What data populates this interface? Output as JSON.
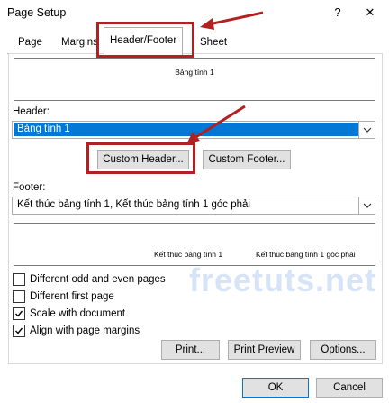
{
  "window": {
    "title": "Page Setup",
    "help_glyph": "?",
    "close_glyph": "✕"
  },
  "tabs": [
    {
      "label": "Page"
    },
    {
      "label": "Margins"
    },
    {
      "label": "Header/Footer",
      "selected": true
    },
    {
      "label": "Sheet"
    }
  ],
  "header_preview": {
    "text": "Bảng tính 1"
  },
  "header": {
    "label": "Header:",
    "value": "Bảng tính 1"
  },
  "buttons": {
    "custom_header": "Custom Header...",
    "custom_footer": "Custom Footer...",
    "print": "Print...",
    "print_preview": "Print Preview",
    "options": "Options...",
    "ok": "OK",
    "cancel": "Cancel"
  },
  "footer": {
    "label": "Footer:",
    "value": "Kết thúc bảng tính 1, Kết thúc bảng tính 1 góc phải"
  },
  "footer_preview": {
    "center_text": "Kết thúc bảng tính 1",
    "right_text": "Kết thúc bảng tính 1 góc phải"
  },
  "options": [
    {
      "label": "Different odd and even pages",
      "checked": false
    },
    {
      "label": "Different first page",
      "checked": false
    },
    {
      "label": "Scale with document",
      "checked": true
    },
    {
      "label": "Align with page margins",
      "checked": true
    }
  ],
  "watermark": "freetuts.net",
  "colors": {
    "selection": "#0078d7",
    "highlight_box": "#b22121",
    "arrow": "#b22121",
    "watermark": "#d7e3f7"
  }
}
